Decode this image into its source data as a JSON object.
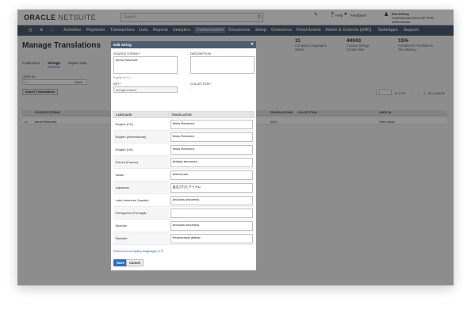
{
  "app": {
    "logo_main": "ORACLE",
    "logo_suite": "NETSUITE",
    "search_placeholder": "Search",
    "top_links": [
      "Help",
      "Feedback"
    ],
    "user_name": "Erin Deviny",
    "user_role": "SuiteSuccess Demo EE PRM - Administrator"
  },
  "nav": {
    "items": [
      "Activities",
      "Payments",
      "Transactions",
      "Lists",
      "Reports",
      "Analytics",
      "Customization",
      "Documents",
      "Setup",
      "Commerce",
      "Fixed Assets",
      "Admin & Controls (GRC)",
      "SuiteApps",
      "Support"
    ],
    "active": "Customization"
  },
  "page": {
    "title": "Manage Translations",
    "tabs": [
      "Collections",
      "Strings",
      "Import Jobs"
    ],
    "active_tab": "Strings",
    "stats": [
      {
        "value": "11",
        "line1": "Company Languages",
        "line2": "Setup"
      },
      {
        "value": "44043",
        "line1": "Custom Strings",
        "line2": "Create New"
      },
      {
        "value": "15%",
        "line1": "Completed Translations",
        "line2": "See Missing"
      }
    ],
    "used_in_label": "USED IN",
    "used_in_value": "1",
    "reset_label": "Reset",
    "import_button": "Import Translations",
    "pagination_value": "1",
    "pagination_of": "of 1762",
    "pagination_range": "1 - 25 of 44043",
    "grid_headers": [
      "SOURCE STRING",
      "TRANSLATIONS",
      "COLLECTION",
      "USED IN"
    ],
    "grid_row": {
      "source": "Items Returned",
      "translations": "10/11",
      "used_in": "Field Label",
      "more": "•••"
    }
  },
  "dialog": {
    "title": "Edit String",
    "source_label": "SOURCE STRING *",
    "source_value": "Items Returned",
    "source_lang": "English (U.S.)",
    "description_label": "DESCRIPTION",
    "description_value": "",
    "key_label": "KEY *",
    "key_value": "autogenerated",
    "collection_label": "COLLECTION *",
    "collection_value": "-",
    "col_language": "LANGUAGE",
    "col_translation": "TRANSLATION",
    "rows": [
      {
        "lang": "English (CA)",
        "value": "Items Returned"
      },
      {
        "lang": "English (International)",
        "value": "Items Returned"
      },
      {
        "lang": "English (UK)",
        "value": "Items Returned"
      },
      {
        "lang": "French (France)",
        "value": "Articles retournés"
      },
      {
        "lang": "Italian",
        "value": "Articoli resi"
      },
      {
        "lang": "Japanese",
        "value": "返品されたアイテム"
      },
      {
        "lang": "Latin American Spanish",
        "value": "Artículos devueltos"
      },
      {
        "lang": "Portuguese (Portugal)",
        "value": ""
      },
      {
        "lang": "Spanish",
        "value": "Artículos devueltos"
      },
      {
        "lang": "Swedish",
        "value": "Returnerade artiklar"
      }
    ],
    "show_link": "Show non-company languages (77)",
    "save_label": "Save",
    "cancel_label": "Cancel"
  }
}
